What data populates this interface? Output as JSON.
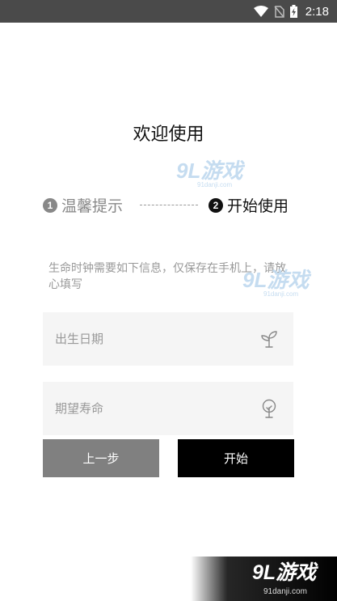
{
  "status_bar": {
    "time": "2:18",
    "icons": [
      "wifi-icon",
      "no-sim-icon",
      "battery-charging-icon"
    ]
  },
  "welcome": {
    "title": "欢迎使用"
  },
  "steps": [
    {
      "number": "1",
      "label": "温馨提示",
      "state": "done"
    },
    {
      "number": "2",
      "label": "开始使用",
      "state": "active"
    }
  ],
  "info": {
    "text": "生命时钟需要如下信息，仅保存在手机上，请放心填写"
  },
  "form": {
    "birth_date": {
      "placeholder": "出生日期",
      "value": "",
      "icon": "sprout-icon"
    },
    "life_expectancy": {
      "placeholder": "期望寿命",
      "value": "",
      "icon": "tree-icon"
    }
  },
  "buttons": {
    "previous": "上一步",
    "start": "开始"
  },
  "watermark": {
    "brand": "9L游戏",
    "site": "91danji.com"
  },
  "colors": {
    "status_bar": "#4a4a4a",
    "previous_button": "#808080",
    "start_button": "#000000",
    "field_bg": "#f5f5f5",
    "placeholder": "#999999"
  }
}
